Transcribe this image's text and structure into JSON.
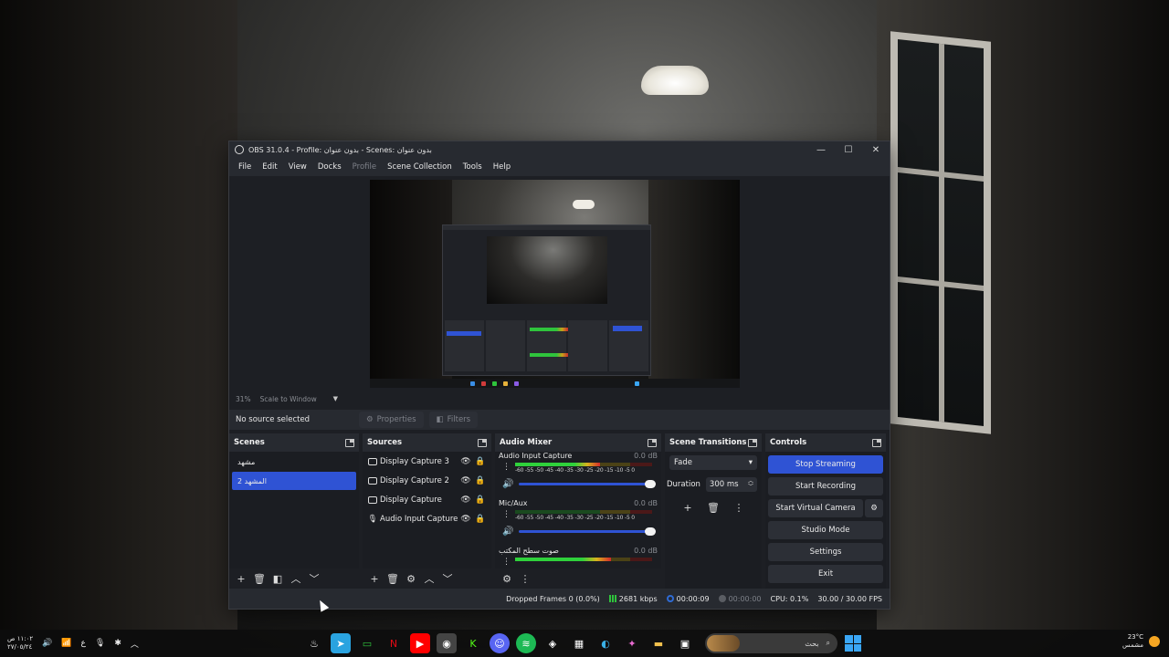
{
  "window": {
    "title": "OBS 31.0.4 - Profile: بدون عنوان - Scenes: بدون عنوان",
    "minimize": "—",
    "maximize": "☐",
    "close": "✕"
  },
  "menu": [
    "File",
    "Edit",
    "View",
    "Docks",
    "Profile",
    "Scene Collection",
    "Tools",
    "Help"
  ],
  "preview": {
    "zoom": "31%",
    "scale_mode": "Scale to Window"
  },
  "context": {
    "no_source": "No source selected",
    "properties": "Properties",
    "filters": "Filters"
  },
  "scenes": {
    "title": "Scenes",
    "items": [
      "مشهد",
      "المشهد 2"
    ],
    "selected_index": 1
  },
  "sources": {
    "title": "Sources",
    "items": [
      {
        "name": "Display Capture 3",
        "type": "display"
      },
      {
        "name": "Display Capture 2",
        "type": "display"
      },
      {
        "name": "Display Capture",
        "type": "display"
      },
      {
        "name": "Audio Input Capture",
        "type": "mic"
      }
    ]
  },
  "mixer": {
    "title": "Audio Mixer",
    "scale": "-60 -55 -50 -45 -40 -35 -30 -25 -20 -15 -10 -5 0",
    "channels": [
      {
        "name": "Audio Input Capture",
        "db": "0.0 dB",
        "level": 0.62
      },
      {
        "name": "Mic/Aux",
        "db": "0.0 dB",
        "level": 0.0
      },
      {
        "name": "صوت سطح المكتب",
        "db": "0.0 dB",
        "level": 0.7
      }
    ]
  },
  "transitions": {
    "title": "Scene Transitions",
    "selected": "Fade",
    "duration_label": "Duration",
    "duration_value": "300 ms"
  },
  "controls": {
    "title": "Controls",
    "stop_streaming": "Stop Streaming",
    "start_recording": "Start Recording",
    "start_virtual_camera": "Start Virtual Camera",
    "studio_mode": "Studio Mode",
    "settings": "Settings",
    "exit": "Exit"
  },
  "status": {
    "dropped_frames": "Dropped Frames 0 (0.0%)",
    "bitrate": "2681 kbps",
    "stream_time": "00:00:09",
    "record_time": "00:00:00",
    "cpu": "CPU: 0.1%",
    "fps": "30.00 / 30.00 FPS"
  },
  "taskbar": {
    "clock_time": "١١:٠٢ ص",
    "clock_date": "٢٧/٠٥/٢٤",
    "lang": "ع",
    "search_placeholder": "بحث",
    "weather_temp": "23°C",
    "weather_desc": "مشمس"
  },
  "colors": {
    "accent": "#2f53d4",
    "panel": "#1d1f24",
    "header": "#272a30"
  }
}
